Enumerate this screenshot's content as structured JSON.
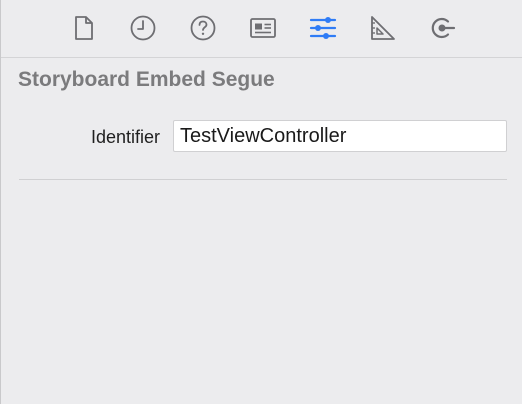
{
  "inspector": {
    "tabs": [
      {
        "name": "file-inspector",
        "icon": "document-icon",
        "active": false
      },
      {
        "name": "history-inspector",
        "icon": "clock-icon",
        "active": false
      },
      {
        "name": "quick-help-inspector",
        "icon": "question-icon",
        "active": false
      },
      {
        "name": "identity-inspector",
        "icon": "id-card-icon",
        "active": false
      },
      {
        "name": "attributes-inspector",
        "icon": "sliders-icon",
        "active": true
      },
      {
        "name": "size-inspector",
        "icon": "ruler-triangle-icon",
        "active": false
      },
      {
        "name": "connections-inspector",
        "icon": "connection-arrow-icon",
        "active": false
      }
    ],
    "colors": {
      "active_tab": "#2f7cf6",
      "inactive_tab": "#6e6e72",
      "section_title": "#7b7b7d"
    }
  },
  "section": {
    "title": "Storyboard Embed Segue",
    "identifier_label": "Identifier",
    "identifier_value": "TestViewController"
  }
}
